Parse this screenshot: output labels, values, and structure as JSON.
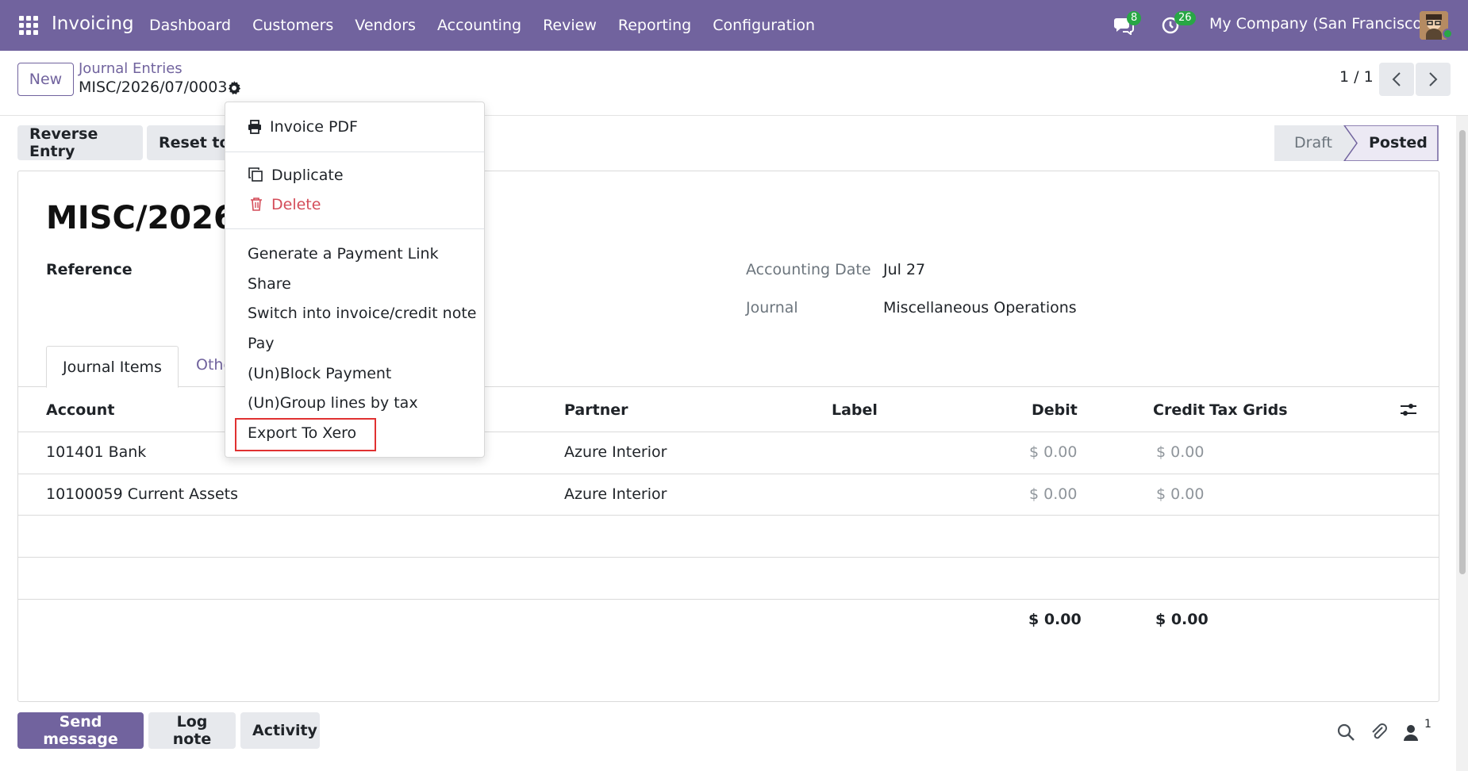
{
  "navbar": {
    "brand": "Invoicing",
    "menu": [
      "Dashboard",
      "Customers",
      "Vendors",
      "Accounting",
      "Review",
      "Reporting",
      "Configuration"
    ],
    "messages_count": "8",
    "activities_count": "26",
    "company": "My Company (San Francisco)"
  },
  "control_panel": {
    "new_label": "New",
    "breadcrumb_parent": "Journal Entries",
    "breadcrumb_current": "MISC/2026/07/0003",
    "pager_value": "1 / 1"
  },
  "actions": {
    "reverse_entry": "Reverse Entry",
    "reset_to": "Reset to "
  },
  "statusbar": {
    "draft": "Draft",
    "posted": "Posted"
  },
  "form": {
    "title": "MISC/2026/0",
    "reference_label": "Reference",
    "accounting_date_label": "Accounting Date",
    "accounting_date_value": "Jul 27",
    "journal_label": "Journal",
    "journal_value": "Miscellaneous Operations"
  },
  "tabs": {
    "journal_items": "Journal Items",
    "other": "Othe"
  },
  "table": {
    "headers": {
      "account": "Account",
      "partner": "Partner",
      "label": "Label",
      "debit": "Debit",
      "credit": "Credit",
      "tax_grids": "Tax Grids"
    },
    "rows": [
      {
        "account": "101401 Bank",
        "partner": "Azure Interior",
        "debit": "$ 0.00",
        "credit": "$ 0.00"
      },
      {
        "account": "10100059 Current Assets",
        "partner": "Azure Interior",
        "debit": "$ 0.00",
        "credit": "$ 0.00"
      }
    ],
    "total_debit": "$ 0.00",
    "total_credit": "$ 0.00"
  },
  "dropdown": {
    "invoice_pdf": "Invoice PDF",
    "duplicate": "Duplicate",
    "delete": "Delete",
    "items": [
      "Generate a Payment Link",
      "Share",
      "Switch into invoice/credit note",
      "Pay",
      "(Un)Block Payment",
      "(Un)Group lines by tax",
      "Export To Xero"
    ]
  },
  "chatter": {
    "send_message": "Send message",
    "log_note": "Log note",
    "activity": "Activity",
    "followers_count": "1"
  },
  "colors": {
    "brand": "#71639e",
    "danger": "#d44c59",
    "success": "#28a745",
    "highlight": "#e03131"
  }
}
